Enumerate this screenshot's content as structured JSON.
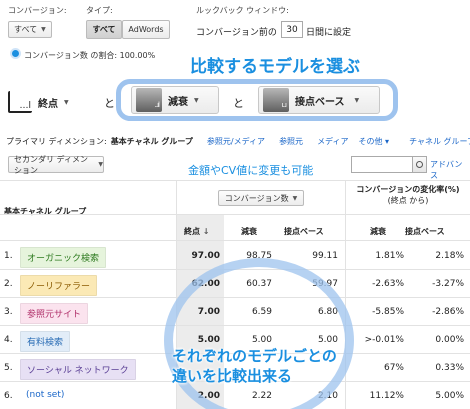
{
  "filters": {
    "conversion_label": "コンバージョン:",
    "conversion_value": "すべて",
    "type_label": "タイプ:",
    "type_buttons": [
      "すべて",
      "AdWords"
    ],
    "lookback_label": "ルックバック ウィンドウ:",
    "lookback_prefix": "コンバージョン前の",
    "lookback_days": "30",
    "lookback_suffix": "日間に設定",
    "ratio_text": "コンバージョン数 の割合: 100.00%"
  },
  "callouts": {
    "compare_models": "比較するモデルを選ぶ",
    "change_metric": "金額やCV値に変更も可能",
    "compare_diff_line1": "それぞれのモデルごとの",
    "compare_diff_line2": "違いを比較出来る"
  },
  "models": {
    "first": "終点",
    "and1": "と",
    "second": "減衰",
    "and2": "と",
    "third": "接点ベース"
  },
  "dimension_bar": {
    "label": "プライマリ ディメンション:",
    "current": "基本チャネル グループ",
    "links": [
      "参照元/メディア",
      "参照元",
      "メディア",
      "その他"
    ],
    "channel_group": "チャネル グループ",
    "secondary": "セカンダリ ディメンション",
    "advanced": "アドバンス"
  },
  "table": {
    "dimension_header": "基本チャネル グループ",
    "metric_select": "コンバージョン数",
    "change_header_line1": "コンバージョンの変化率(%)",
    "change_header_line2": "(終点 から)",
    "sub_headers": [
      "終点",
      "減衰",
      "接点ベース",
      "減衰",
      "接点ベース"
    ],
    "rows": [
      {
        "idx": "1.",
        "channel": "オーガニック検索",
        "color": "#e6f4dc",
        "fg": "#2d7a1f",
        "v1": "97.00",
        "v2": "98.75",
        "v3": "99.11",
        "c1": "1.81%",
        "c2": "2.18%"
      },
      {
        "idx": "2.",
        "channel": "ノーリファラー",
        "color": "#fbe9b5",
        "fg": "#8a5a00",
        "v1": "62.00",
        "v2": "60.37",
        "v3": "59.97",
        "c1": "-2.63%",
        "c2": "-3.27%"
      },
      {
        "idx": "3.",
        "channel": "参照元サイト",
        "color": "#fbe3ee",
        "fg": "#b0306a",
        "v1": "7.00",
        "v2": "6.59",
        "v3": "6.80",
        "c1": "-5.85%",
        "c2": "-2.86%"
      },
      {
        "idx": "4.",
        "channel": "有料検索",
        "color": "#e2edf8",
        "fg": "#2a6db5",
        "v1": "5.00",
        "v2": "5.00",
        "v3": "5.00",
        "c1": ">-0.01%",
        "c2": "0.00%"
      },
      {
        "idx": "5.",
        "channel": "ソーシャル ネットワーク",
        "color": "#e7e0f4",
        "fg": "#5a3f95",
        "v1": "",
        "v2": "",
        "v3": "",
        "c1": "67%",
        "c2": "0.33%"
      },
      {
        "idx": "6.",
        "channel": "(not set)",
        "color": "#ffffff",
        "fg": "#1a66c8",
        "v1": "2.00",
        "v2": "2.22",
        "v3": "2.10",
        "c1": "11.12%",
        "c2": "5.00%"
      }
    ]
  },
  "colors": {
    "accent": "#1a8fe0",
    "link": "#1a66c8",
    "annotation_ring": "#9ec3ee"
  }
}
